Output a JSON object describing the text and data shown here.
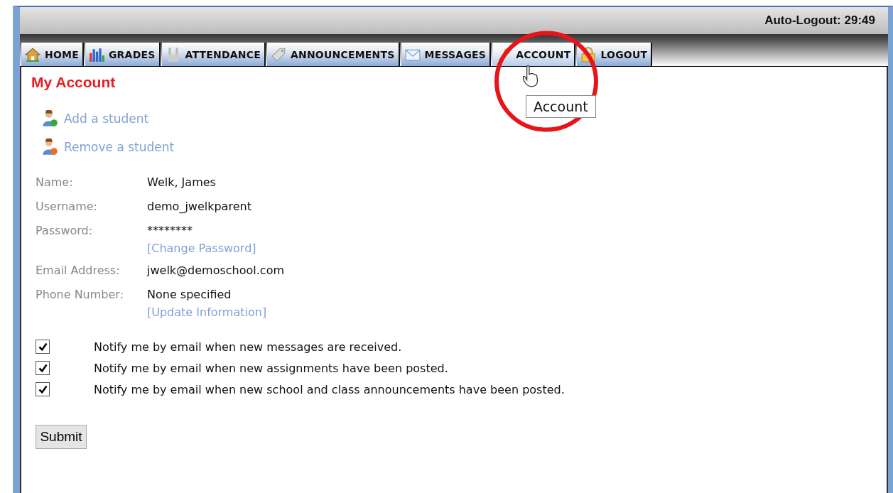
{
  "header": {
    "auto_logout": "Auto-Logout: 29:49"
  },
  "tabs": [
    {
      "label": "HOME",
      "kind": "home",
      "selected": false
    },
    {
      "label": "GRADES",
      "kind": "grades",
      "selected": false
    },
    {
      "label": "ATTENDANCE",
      "kind": "attendance",
      "selected": false
    },
    {
      "label": "ANNOUNCEMENTS",
      "kind": "announcements",
      "selected": false
    },
    {
      "label": "MESSAGES",
      "kind": "messages",
      "selected": false
    },
    {
      "label": "ACCOUNT",
      "kind": "account",
      "selected": true
    },
    {
      "label": "LOGOUT",
      "kind": "logout",
      "selected": false
    }
  ],
  "tooltip": "Account",
  "page_title": "My Account",
  "actions": [
    {
      "label": "Add a student",
      "kind": "add"
    },
    {
      "label": "Remove a student",
      "kind": "remove"
    }
  ],
  "fields": [
    {
      "label": "Name:",
      "value": "Welk, James"
    },
    {
      "label": "Username:",
      "value": "demo_jwelkparent"
    },
    {
      "label": "Password:",
      "value": "********",
      "link": "[Change Password]"
    },
    {
      "label": "Email Address:",
      "value": "jwelk@demoschool.com"
    },
    {
      "label": "Phone Number:",
      "value": "None specified",
      "link": "[Update Information]"
    }
  ],
  "notifications": [
    {
      "label": "Notify me by email when new messages are received.",
      "checked": true
    },
    {
      "label": "Notify me by email when new assignments have been posted.",
      "checked": true
    },
    {
      "label": "Notify me by email when new school and class announcements have been posted.",
      "checked": true
    }
  ],
  "submit": "Submit"
}
